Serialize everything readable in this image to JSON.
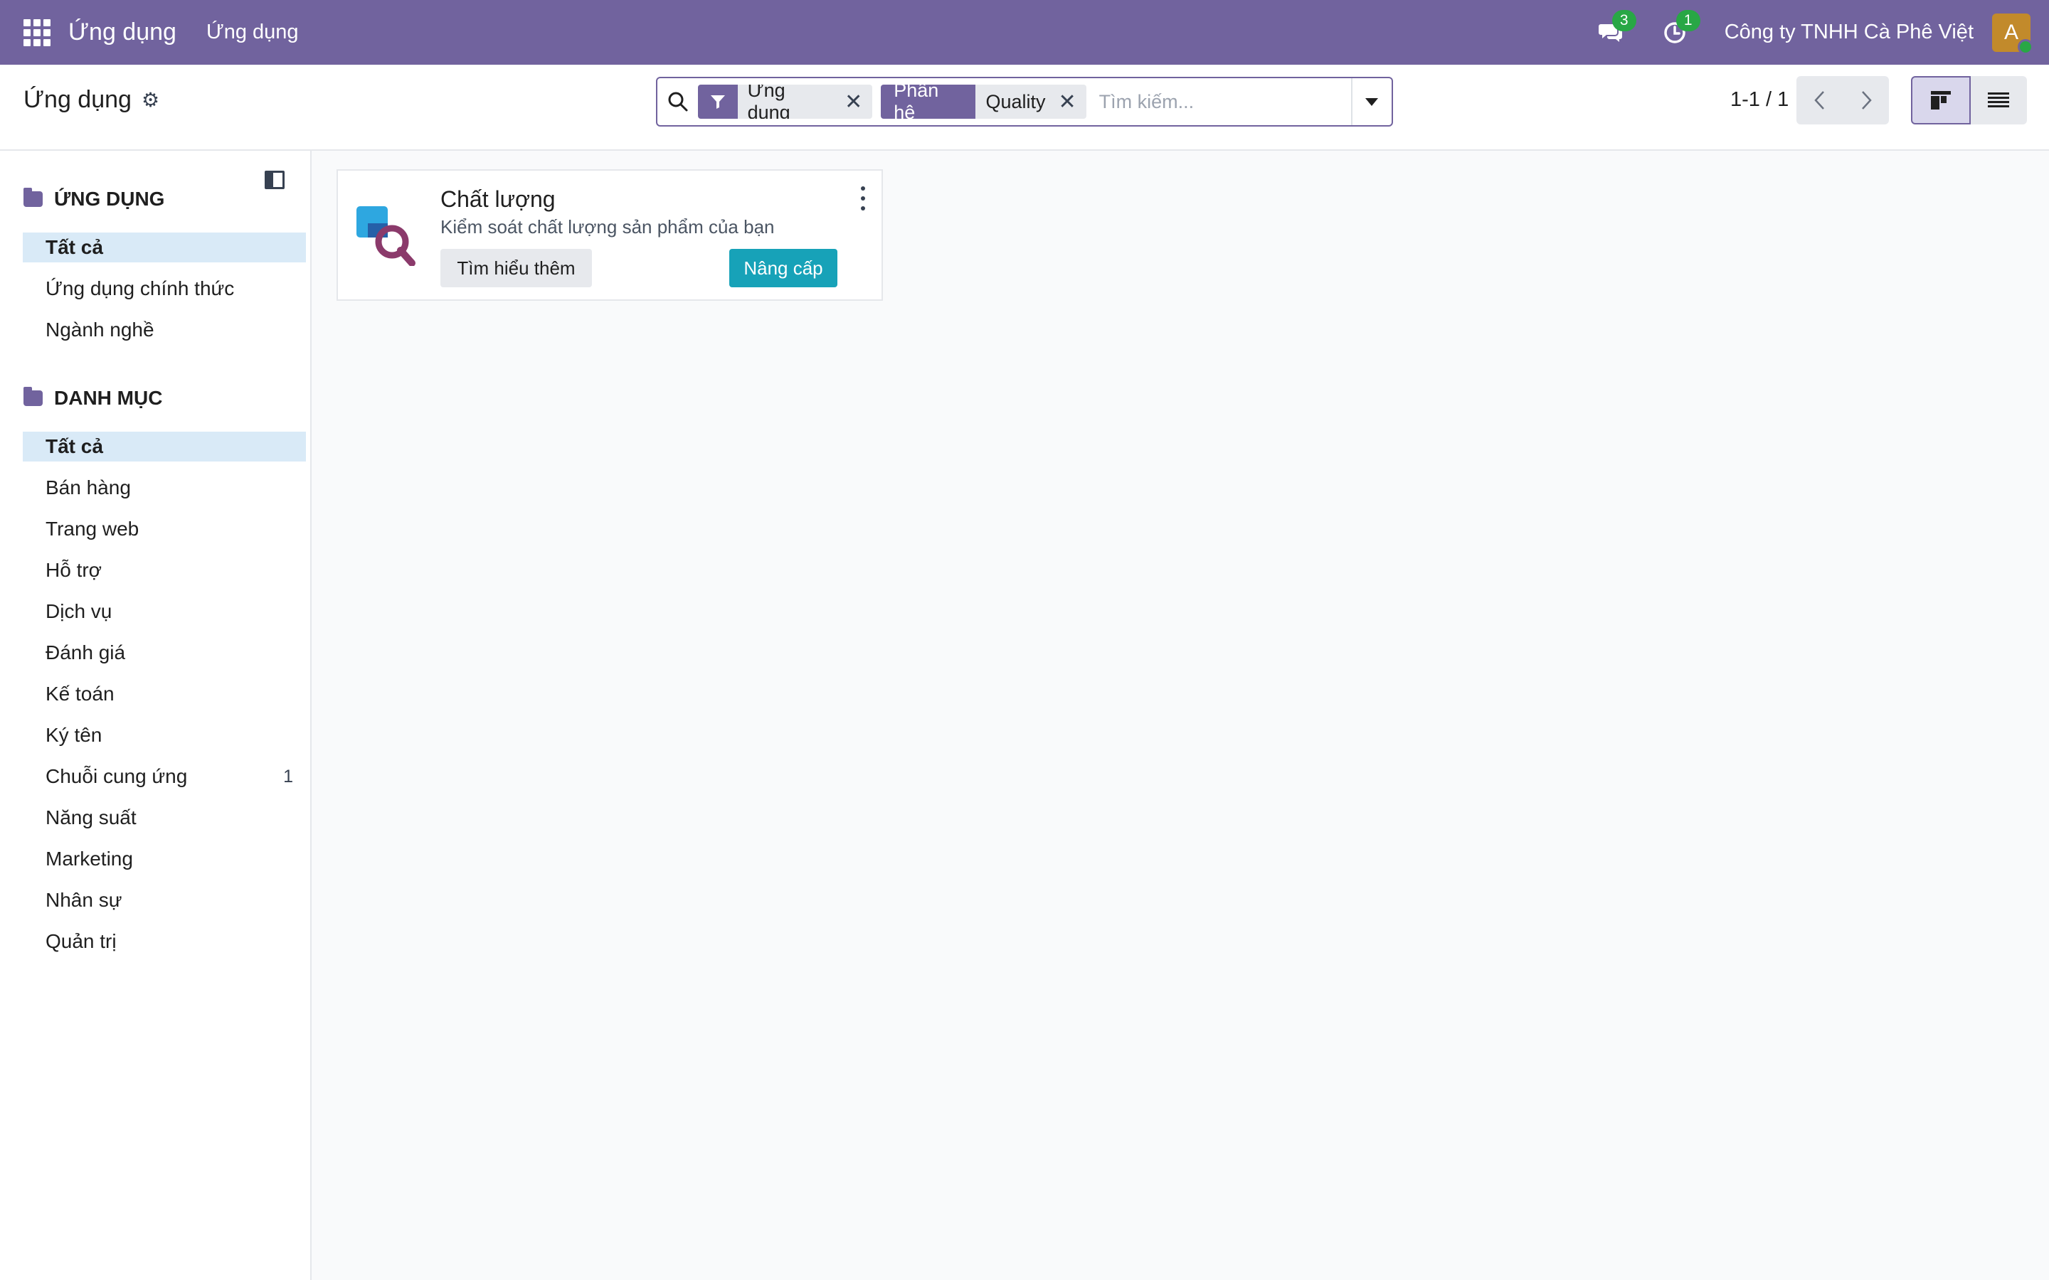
{
  "navbar": {
    "brand": "Ứng dụng",
    "menu_item": "Ứng dụng",
    "messages_count": "3",
    "activities_count": "1",
    "company": "Công ty TNHH Cà Phê Việt",
    "avatar_letter": "A"
  },
  "control_panel": {
    "breadcrumb": "Ứng dụng",
    "search": {
      "facets": [
        {
          "label_icon": "filter-icon",
          "value": "Ứng dụng"
        },
        {
          "label": "Phân hệ",
          "value": "Quality"
        }
      ],
      "placeholder": "Tìm kiếm..."
    },
    "pager": "1-1 / 1"
  },
  "sidebar": {
    "sections": [
      {
        "title": "ỨNG DỤNG",
        "items": [
          {
            "label": "Tất cả",
            "active": true
          },
          {
            "label": "Ứng dụng chính thức"
          },
          {
            "label": "Ngành nghề"
          }
        ]
      },
      {
        "title": "DANH MỤC",
        "items": [
          {
            "label": "Tất cả",
            "active": true
          },
          {
            "label": "Bán hàng"
          },
          {
            "label": "Trang web"
          },
          {
            "label": "Hỗ trợ"
          },
          {
            "label": "Dịch vụ"
          },
          {
            "label": "Đánh giá"
          },
          {
            "label": "Kế toán"
          },
          {
            "label": "Ký tên"
          },
          {
            "label": "Chuỗi cung ứng",
            "count": "1"
          },
          {
            "label": "Năng suất"
          },
          {
            "label": "Marketing"
          },
          {
            "label": "Nhân sự"
          },
          {
            "label": "Quản trị"
          }
        ]
      }
    ]
  },
  "apps": [
    {
      "name": "Chất lượng",
      "description": "Kiểm soát chất lượng sản phẩm của bạn",
      "learn_more": "Tìm hiểu thêm",
      "upgrade": "Nâng cấp"
    }
  ],
  "colors": {
    "brand": "#71639e",
    "upgrade": "#17a2b8",
    "badge": "#28a745",
    "active_item": "#d9eaf7"
  }
}
